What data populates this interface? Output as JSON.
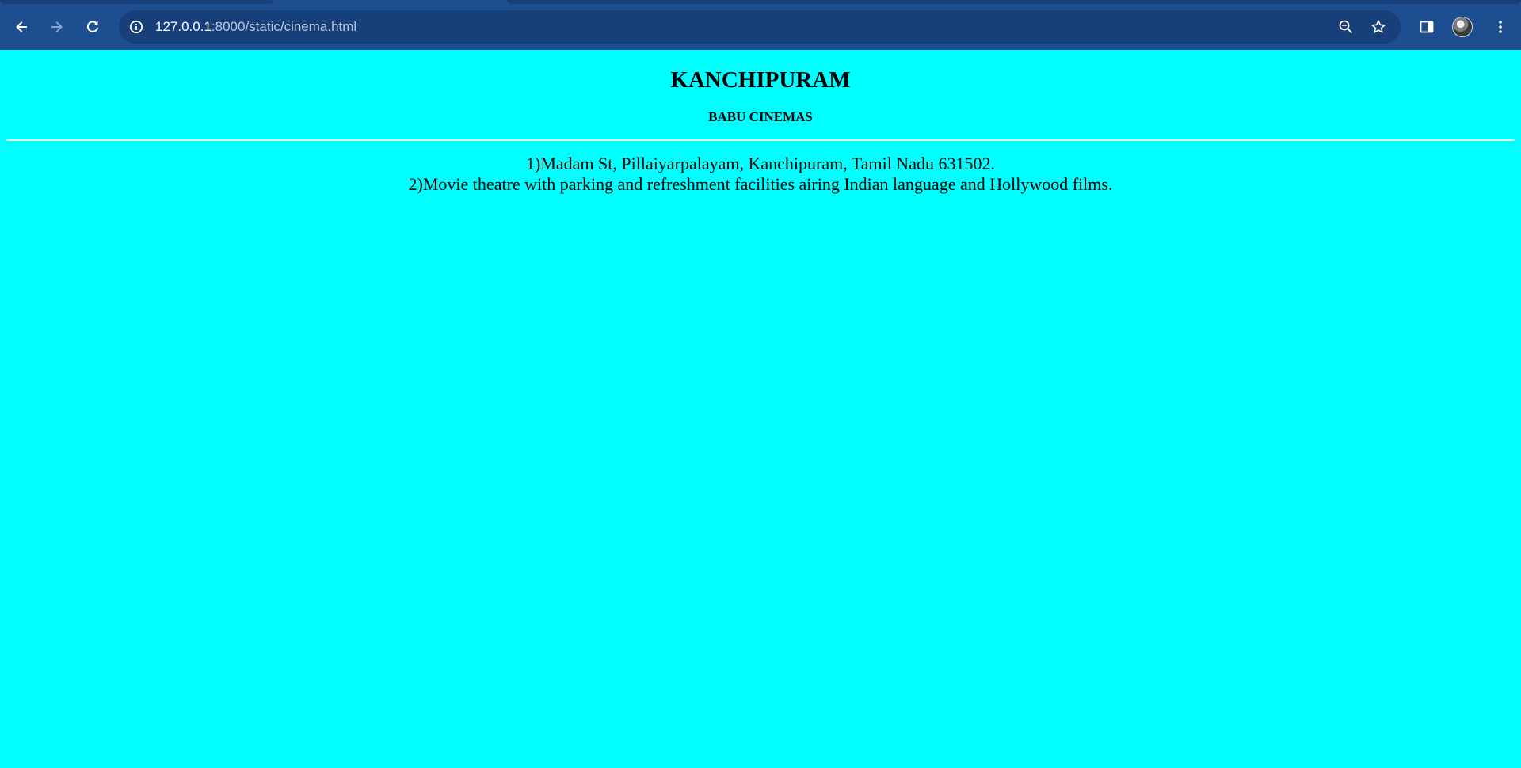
{
  "browser": {
    "url_host": "127.0.0.1",
    "url_path": ":8000/static/cinema.html",
    "icons": {
      "back": "arrow-left-icon",
      "forward": "arrow-right-icon",
      "reload": "reload-icon",
      "site_info": "info-icon",
      "zoom": "zoom-out-icon",
      "bookmark": "star-icon",
      "side_panel": "side-panel-icon",
      "menu": "kebab-menu-icon"
    },
    "colors": {
      "toolbar": "#1d4e8f",
      "omnibox": "#17407a"
    }
  },
  "page": {
    "background": "#00ffff",
    "title": "KANCHIPURAM",
    "subtitle": "BABU CINEMAS",
    "lines": [
      "1)Madam St, Pillaiyarpalayam, Kanchipuram, Tamil Nadu 631502.",
      "2)Movie theatre with parking and refreshment facilities airing Indian language and Hollywood films."
    ]
  }
}
